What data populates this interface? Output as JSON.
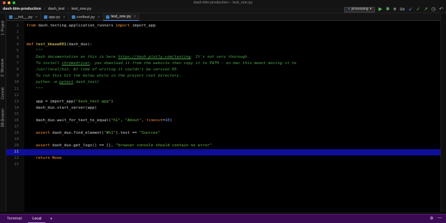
{
  "window": {
    "title": "dash-blm-production – test_one.py"
  },
  "traffic_colors": [
    "#ff5f57",
    "#febc2e",
    "#28c840"
  ],
  "breadcrumbs": [
    "dash-blm-production",
    "dash_test",
    "test_one.py"
  ],
  "toolbar": {
    "run_config": "processing",
    "git_label": "Git:",
    "icons": [
      "run-icon",
      "debug-icon",
      "stop-icon",
      "git-update-icon",
      "git-commit-icon",
      "history-icon",
      "rollback-icon"
    ]
  },
  "tabs": [
    {
      "label": "__init__.py",
      "active": false
    },
    {
      "label": "app.py",
      "active": false
    },
    {
      "label": "conftest.py",
      "active": false
    },
    {
      "label": "test_one.py",
      "active": true
    }
  ],
  "left_panels": [
    "1: Project",
    "Z: Structure",
    "Commit",
    "DB Browser"
  ],
  "code_lines": [
    {
      "n": "1",
      "html": "<span class=\"kw\">from</span> dash.testing.application_runners <span class=\"kw\">import</span> import_app"
    },
    {
      "n": "2",
      "html": ""
    },
    {
      "n": "3",
      "html": ""
    },
    {
      "n": "4",
      "html": "<span class=\"kw\">def</span> <span class=\"fn\">test_bbaaa001</span>(dash_duo):"
    },
    {
      "n": "5",
      "html": "    <span class=\"doc\">\"\"\"</span>"
    },
    {
      "n": "6",
      "html": "    <span class=\"doc\">Dash documentation on this is here <a>https://dash.plotly.com/testing</a>. It's not very thorough.</span>"
    },
    {
      "n": "7",
      "html": "    <span class=\"doc\">To install <a>chromedriver</a>, you download it from the website then copy it to PATH - on mac this meant moving it to</span>"
    },
    {
      "n": "8",
      "html": "    <span class=\"doc\">/usr/local/bin. At time of writing it couldn't be version 85.</span>"
    },
    {
      "n": "9",
      "html": "    <span class=\"doc\">To run this hit the below while in the project root directory.</span>"
    },
    {
      "n": "10",
      "html": "    <span class=\"doc\">python -m <a>pytest</a> dash_test/</span>"
    },
    {
      "n": "11",
      "html": "    <span class=\"doc\">\"\"\"</span>"
    },
    {
      "n": "12",
      "html": ""
    },
    {
      "n": "13",
      "html": "    app = import_app(<span class=\"str\">\"dash_test.app\"</span>)"
    },
    {
      "n": "14",
      "html": "    dash_duo.start_server(app)"
    },
    {
      "n": "15",
      "html": ""
    },
    {
      "n": "16",
      "html": "    dash_duo.wait_for_text_to_equal(<span class=\"str\">\"h1\"</span>, <span class=\"str\">\"About\"</span>, <span class=\"kwarg\">timeout</span>=<span class=\"num\">10</span>)"
    },
    {
      "n": "17",
      "html": ""
    },
    {
      "n": "18",
      "html": "    <span class=\"kw\">assert</span> dash_duo.find_element(<span class=\"str\">\"#h1\"</span>).text == <span class=\"str\">\"Sources\"</span>"
    },
    {
      "n": "19",
      "html": ""
    },
    {
      "n": "20",
      "html": "    <span class=\"kw\">assert</span> dash_duo.get_logs() == [], <span class=\"str\">\"browser console should contain no error\"</span>"
    },
    {
      "n": "21",
      "html": "",
      "current": true
    },
    {
      "n": "22",
      "html": "    <span class=\"kw\">return</span> <span class=\"kw\">None</span>"
    },
    {
      "n": "23",
      "html": ""
    }
  ],
  "terminal": {
    "label": "Terminal:",
    "tab": "Local",
    "add": "+"
  }
}
